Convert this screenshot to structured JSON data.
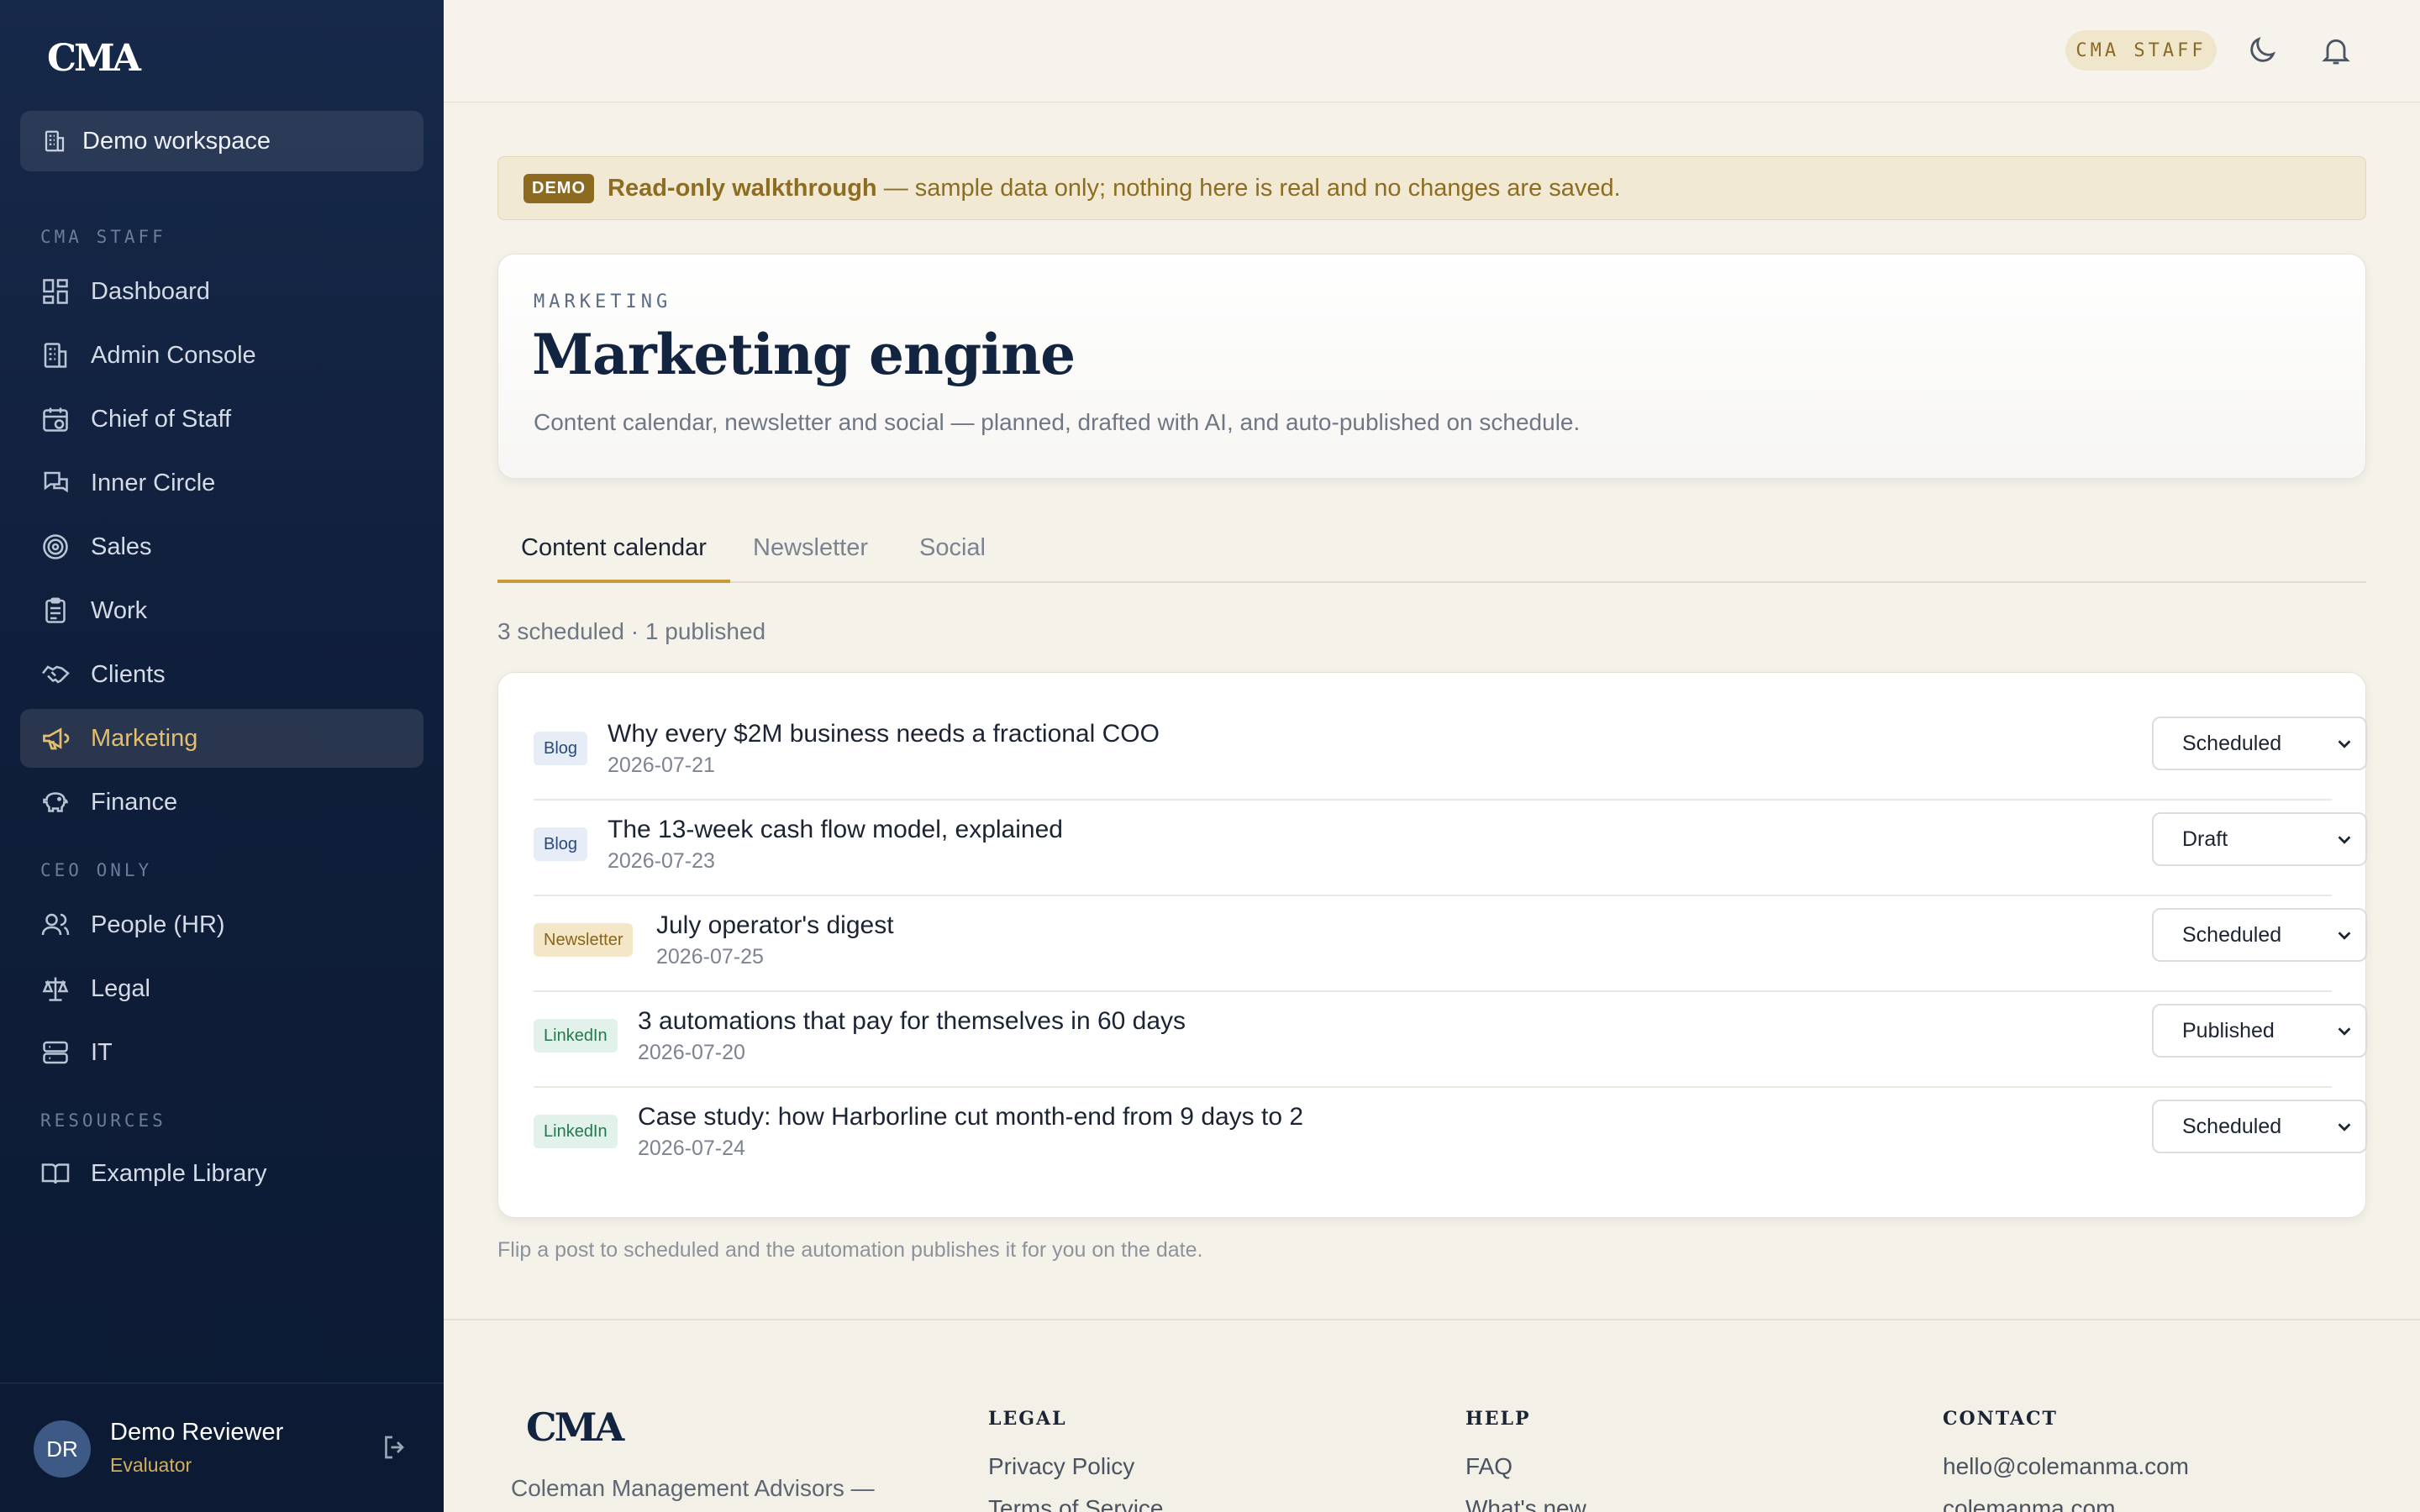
{
  "brand": {
    "logo_text": "CMA"
  },
  "sidebar": {
    "workspace_label": "Demo workspace",
    "sections": {
      "staff": "CMA STAFF",
      "ceo": "CEO ONLY",
      "resources": "RESOURCES"
    },
    "items": [
      {
        "label": "Dashboard",
        "icon": "grid-icon"
      },
      {
        "label": "Admin Console",
        "icon": "building-icon"
      },
      {
        "label": "Chief of Staff",
        "icon": "calendar-check-icon"
      },
      {
        "label": "Inner Circle",
        "icon": "chat-bubbles-icon"
      },
      {
        "label": "Sales",
        "icon": "target-icon"
      },
      {
        "label": "Work",
        "icon": "clipboard-icon"
      },
      {
        "label": "Clients",
        "icon": "handshake-icon"
      },
      {
        "label": "Marketing",
        "icon": "megaphone-icon",
        "active": true
      },
      {
        "label": "Finance",
        "icon": "piggy-bank-icon"
      },
      {
        "label": "People (HR)",
        "icon": "users-icon"
      },
      {
        "label": "Legal",
        "icon": "scale-icon"
      },
      {
        "label": "IT",
        "icon": "server-icon"
      },
      {
        "label": "Example Library",
        "icon": "book-icon"
      }
    ],
    "user": {
      "initials": "DR",
      "name": "Demo Reviewer",
      "role": "Evaluator"
    }
  },
  "topbar": {
    "staff_badge": "CMA STAFF",
    "icons": [
      "moon-icon",
      "bell-icon"
    ]
  },
  "banner": {
    "badge": "DEMO",
    "title": "Read-only walkthrough",
    "text": " — sample data only; nothing here is real and no changes are saved."
  },
  "header": {
    "eyebrow": "MARKETING",
    "title": "Marketing engine",
    "subtitle": "Content calendar, newsletter and social — planned, drafted with AI, and auto-published on schedule."
  },
  "tabs": [
    {
      "label": "Content calendar",
      "active": true
    },
    {
      "label": "Newsletter"
    },
    {
      "label": "Social"
    }
  ],
  "summary": "3 scheduled · 1 published",
  "posts": [
    {
      "type": "Blog",
      "title": "Why every $2M business needs a fractional COO",
      "date": "2026-07-21",
      "status": "Scheduled"
    },
    {
      "type": "Blog",
      "title": "The 13-week cash flow model, explained",
      "date": "2026-07-23",
      "status": "Draft"
    },
    {
      "type": "Newsletter",
      "title": "July operator's digest",
      "date": "2026-07-25",
      "status": "Scheduled"
    },
    {
      "type": "LinkedIn",
      "title": "3 automations that pay for themselves in 60 days",
      "date": "2026-07-20",
      "status": "Published"
    },
    {
      "type": "LinkedIn",
      "title": "Case study: how Harborline cut month-end from 9 days to 2",
      "date": "2026-07-24",
      "status": "Scheduled"
    }
  ],
  "hint": "Flip a post to scheduled and the automation publishes it for you on the date.",
  "footer": {
    "logo_text": "CMA",
    "tagline": "Coleman Management Advisors —",
    "columns": {
      "legal": {
        "heading": "LEGAL",
        "links": [
          "Privacy Policy",
          "Terms of Service"
        ]
      },
      "help": {
        "heading": "HELP",
        "links": [
          "FAQ",
          "What's new"
        ]
      },
      "contact": {
        "heading": "CONTACT",
        "links": [
          "hello@colemanma.com",
          "colemanma.com"
        ]
      }
    }
  },
  "colors": {
    "navy": "#0f1e3a",
    "gold": "#c69a3e",
    "active_nav": "#e2bf6e"
  }
}
